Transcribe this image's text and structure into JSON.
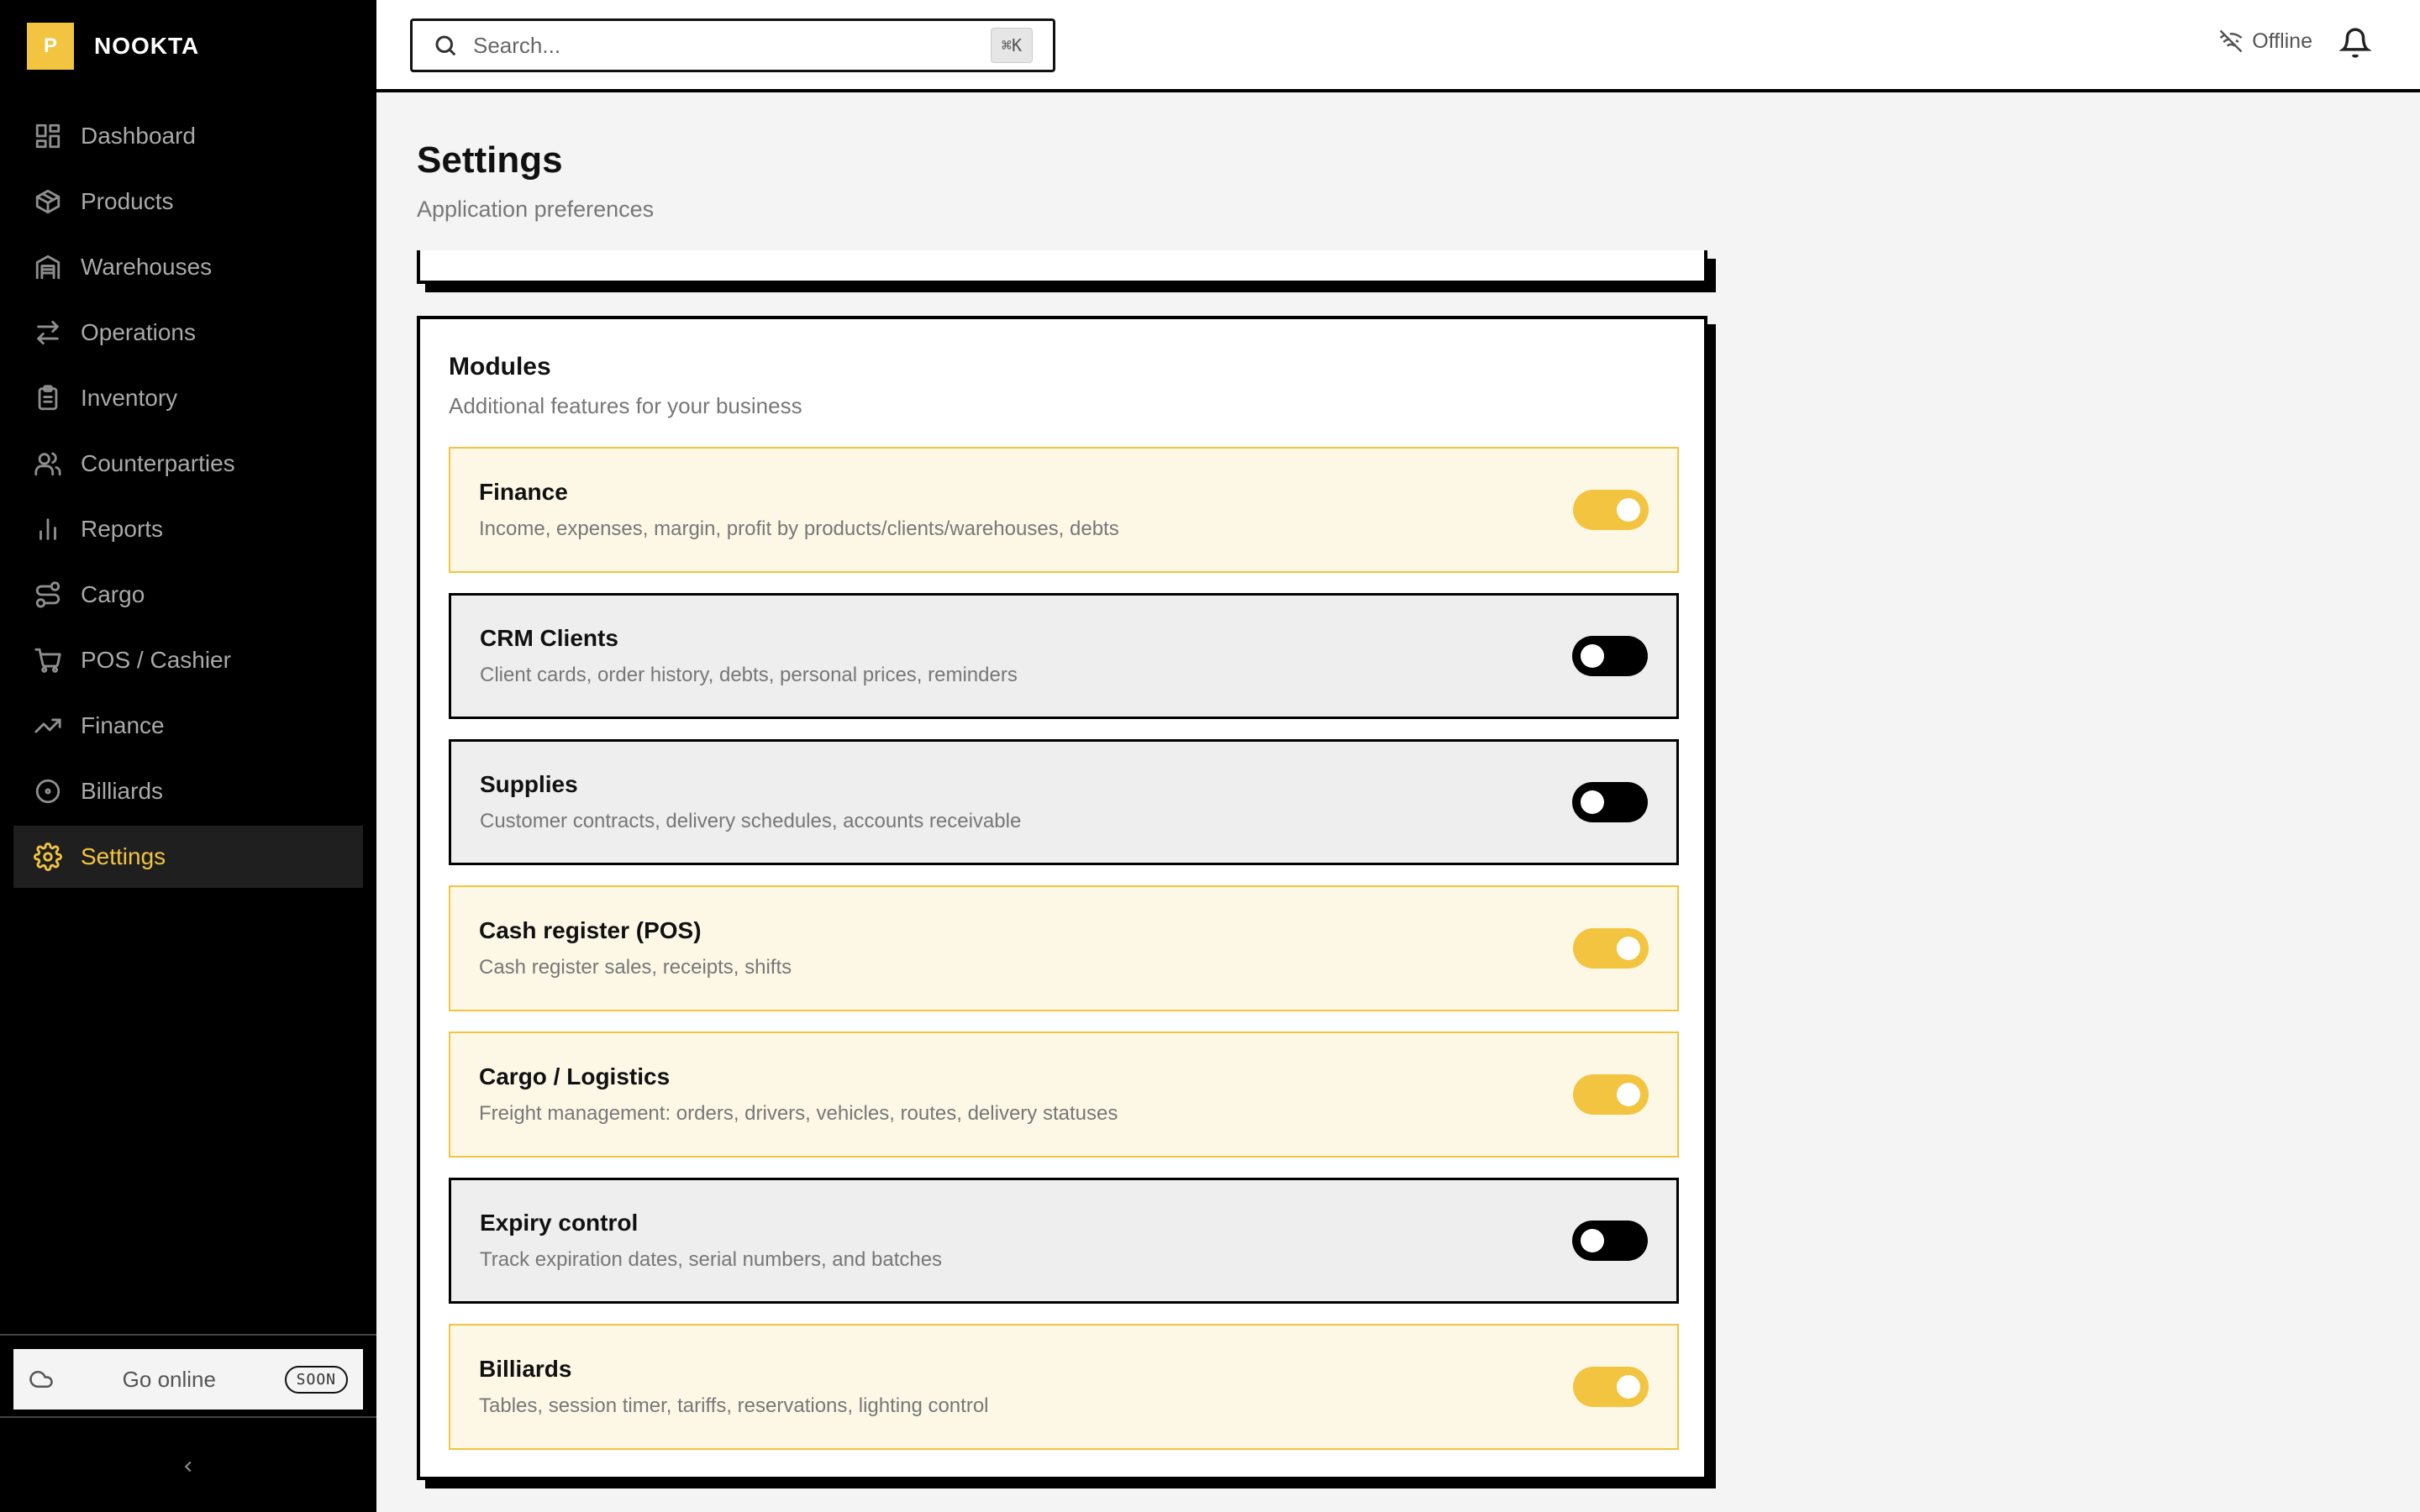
{
  "brand": {
    "logo_letter": "P",
    "name": "NOOKTA",
    "accent": "#f2c440"
  },
  "sidebar": {
    "items": [
      {
        "label": "Dashboard",
        "icon": "dashboard-grid-icon",
        "active": false
      },
      {
        "label": "Products",
        "icon": "box-icon",
        "active": false
      },
      {
        "label": "Warehouses",
        "icon": "warehouse-icon",
        "active": false
      },
      {
        "label": "Operations",
        "icon": "arrows-exchange-icon",
        "active": false
      },
      {
        "label": "Inventory",
        "icon": "clipboard-icon",
        "active": false
      },
      {
        "label": "Counterparties",
        "icon": "users-icon",
        "active": false
      },
      {
        "label": "Reports",
        "icon": "bar-chart-icon",
        "active": false
      },
      {
        "label": "Cargo",
        "icon": "route-icon",
        "active": false
      },
      {
        "label": "POS / Cashier",
        "icon": "cart-icon",
        "active": false
      },
      {
        "label": "Finance",
        "icon": "trending-up-icon",
        "active": false
      },
      {
        "label": "Billiards",
        "icon": "circle-dot-icon",
        "active": false
      },
      {
        "label": "Settings",
        "icon": "gear-icon",
        "active": true
      }
    ],
    "go_online": {
      "label": "Go online",
      "badge": "SOON",
      "icon": "cloud-icon"
    },
    "collapse_icon": "chevron-left-icon"
  },
  "topbar": {
    "search": {
      "placeholder": "Search...",
      "value": "",
      "shortcut": "⌘K"
    },
    "status": {
      "label": "Offline",
      "icon": "wifi-off-icon"
    },
    "notifications_icon": "bell-icon"
  },
  "page": {
    "title": "Settings",
    "subtitle": "Application preferences"
  },
  "modules": {
    "title": "Modules",
    "subtitle": "Additional features for your business",
    "items": [
      {
        "name": "Finance",
        "description": "Income, expenses, margin, profit by products/clients/warehouses, debts",
        "enabled": true
      },
      {
        "name": "CRM Clients",
        "description": "Client cards, order history, debts, personal prices, reminders",
        "enabled": false
      },
      {
        "name": "Supplies",
        "description": "Customer contracts, delivery schedules, accounts receivable",
        "enabled": false
      },
      {
        "name": "Cash register (POS)",
        "description": "Cash register sales, receipts, shifts",
        "enabled": true
      },
      {
        "name": "Cargo / Logistics",
        "description": "Freight management: orders, drivers, vehicles, routes, delivery statuses",
        "enabled": true
      },
      {
        "name": "Expiry control",
        "description": "Track expiration dates, serial numbers, and batches",
        "enabled": false
      },
      {
        "name": "Billiards",
        "description": "Tables, session timer, tariffs, reservations, lighting control",
        "enabled": true
      }
    ]
  }
}
